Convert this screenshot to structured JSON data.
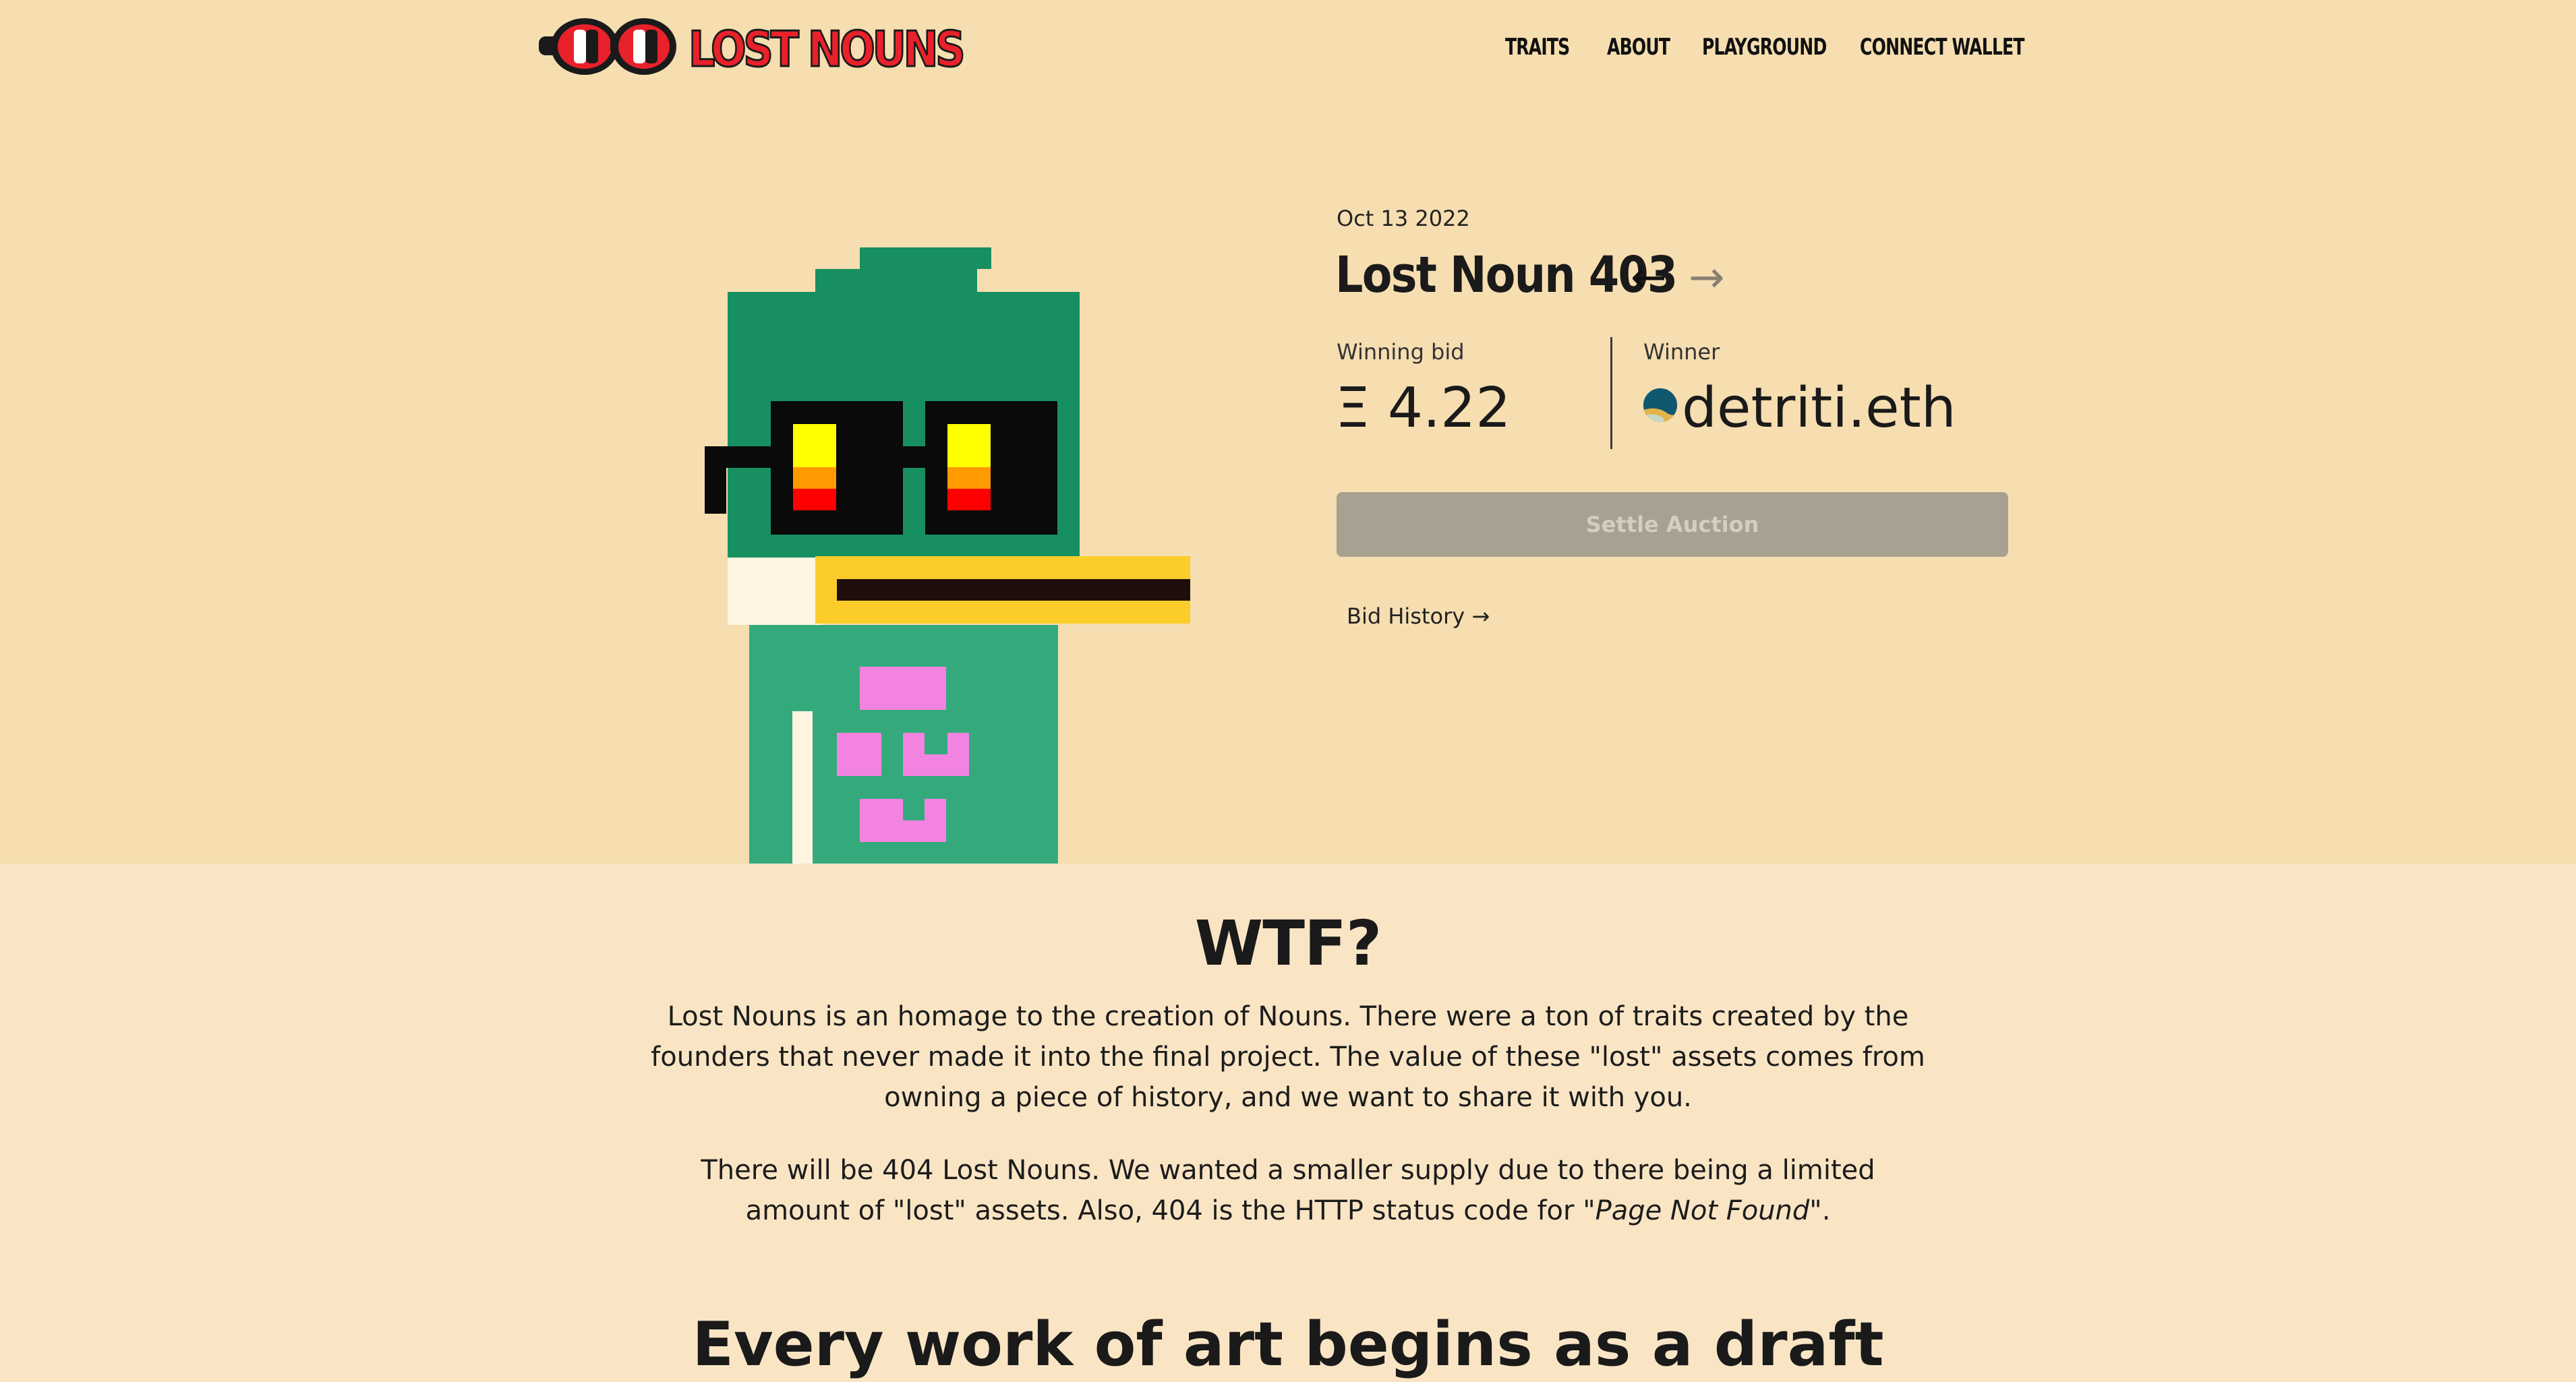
{
  "header": {
    "logo_text": "LOST NOUNS",
    "nav": [
      "TRAITS",
      "ABOUT",
      "PLAYGROUND",
      "CONNECT WALLET"
    ]
  },
  "auction": {
    "date": "Oct 13 2022",
    "title": "Lost Noun 403",
    "prev_arrow": "←",
    "next_arrow": "→",
    "winning_bid_label": "Winning bid",
    "winning_bid_value": "Ξ 4.22",
    "winner_label": "Winner",
    "winner_value": "detriti.eth",
    "settle_button": "Settle Auction",
    "bid_history_link": "Bid History →"
  },
  "about": {
    "heading": "WTF?",
    "paragraph1": "Lost Nouns is an homage to the creation of Nouns. There were a ton of traits created by the founders that never made it into the final project. The value of these \"lost\" assets comes from owning a piece of history, and we want to share it with you.",
    "paragraph2_main": "There will be 404 Lost Nouns. We wanted a smaller supply due to there being a limited amount of \"lost\" assets. Also, 404 is the HTTP status code for ",
    "paragraph2_italic": "\"Page Not Found\"",
    "paragraph2_end": ".",
    "next_heading": "Every work of art begins as a draft"
  },
  "colors": {
    "hero_bg": "#f6deb1",
    "lower_bg": "#f9e5c4",
    "logo_red": "#e8212a",
    "noun_head_green": "#178f60",
    "noun_body_green": "#34aa7c",
    "beak_yellow": "#fccd2a",
    "eye_yellow": "#ffff00",
    "eye_orange": "#ff9a00",
    "eye_red": "#ff0000",
    "shirt_pink": "#f383e1",
    "settle_button_bg": "#a8a091",
    "winner_avatar": "#0f5870"
  },
  "icons": {
    "logo": "noggles-glasses-icon",
    "winner_avatar": "ens-avatar-icon",
    "prev": "arrow-left-icon",
    "next": "arrow-right-icon"
  }
}
